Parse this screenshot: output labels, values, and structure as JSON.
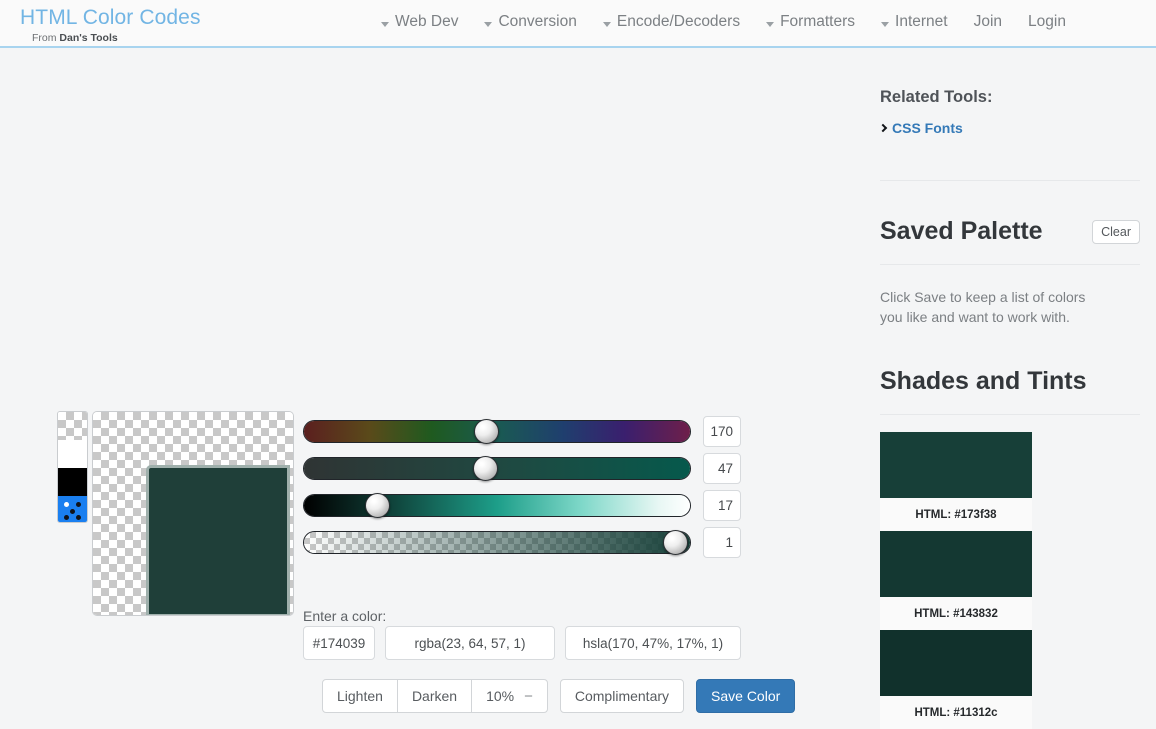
{
  "header": {
    "brand_title": "HTML Color Codes",
    "brand_sub_prefix": "From ",
    "brand_sub_strong": "Dan's Tools",
    "nav": [
      {
        "label": "Web Dev",
        "caret": true
      },
      {
        "label": "Conversion",
        "caret": true
      },
      {
        "label": "Encode/Decoders",
        "caret": true
      },
      {
        "label": "Formatters",
        "caret": true
      },
      {
        "label": "Internet",
        "caret": true
      },
      {
        "label": "Join",
        "caret": false
      },
      {
        "label": "Login",
        "caret": false
      }
    ]
  },
  "picker": {
    "preview_color": "#1f3f39",
    "swatches": [
      {
        "name": "transparent-swatch"
      },
      {
        "name": "white-swatch",
        "color": "#ffffff"
      },
      {
        "name": "black-swatch",
        "color": "#000000"
      },
      {
        "name": "random-swatch",
        "color": "#1a7ff0"
      }
    ]
  },
  "sliders": [
    {
      "name": "hue-slider",
      "value": "170",
      "knob_pct": 47.2
    },
    {
      "name": "saturation-slider",
      "value": "47",
      "knob_pct": 46.9
    },
    {
      "name": "lightness-slider",
      "value": "17",
      "knob_pct": 19.0
    },
    {
      "name": "alpha-slider",
      "value": "1",
      "knob_pct": 96.0
    }
  ],
  "color_form": {
    "enter_label": "Enter a color:",
    "hex": "#174039",
    "rgba": "rgba(23, 64, 57, 1)",
    "hsla": "hsla(170, 47%, 17%, 1)"
  },
  "buttons": {
    "lighten": "Lighten",
    "darken": "Darken",
    "step_amount": "10%",
    "step_minus": "−",
    "complimentary": "Complimentary",
    "save_color": "Save Color"
  },
  "sidebar": {
    "related_tools_title": "Related Tools:",
    "related_link": "CSS Fonts",
    "saved_palette_title": "Saved Palette",
    "clear_label": "Clear",
    "palette_empty_text": "Click Save to keep a list of colors you like and want to work with.",
    "shades_title": "Shades and Tints",
    "shades": [
      {
        "color": "#173f38",
        "label": "HTML: #173f38"
      },
      {
        "color": "#143832",
        "label": "HTML: #143832"
      },
      {
        "color": "#11312c",
        "label": "HTML: #11312c"
      }
    ]
  }
}
